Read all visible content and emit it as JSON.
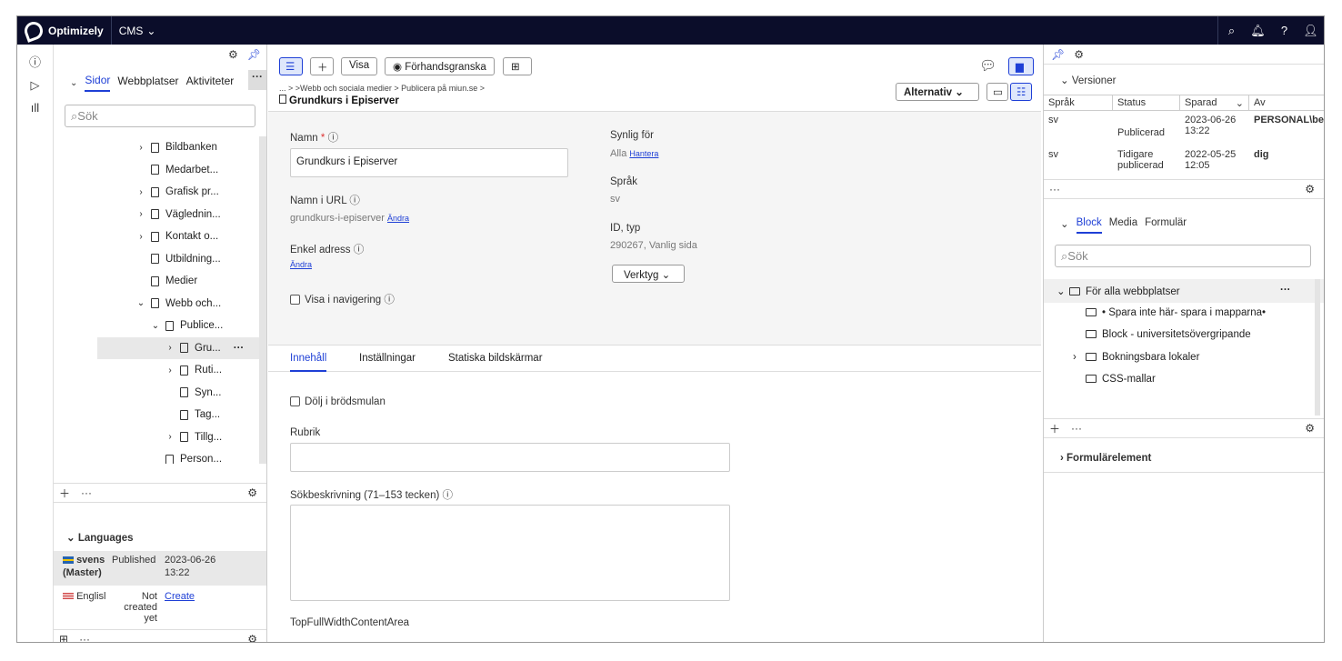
{
  "topbar": {
    "brand": "Optimizely",
    "product": "CMS"
  },
  "left": {
    "tabs": [
      "Sidor",
      "Webbplatser",
      "Aktiviteter"
    ],
    "search_placeholder": "Sök",
    "tree": [
      {
        "label": "Bildbanken",
        "indent": 0,
        "expand": true
      },
      {
        "label": "Medarbet...",
        "indent": 0,
        "expand": false
      },
      {
        "label": "Grafisk pr...",
        "indent": 0,
        "expand": true
      },
      {
        "label": "Vägledni­n...",
        "indent": 0,
        "expand": true
      },
      {
        "label": "Kontakt o...",
        "indent": 0,
        "expand": true
      },
      {
        "label": "Utbildning...",
        "indent": 0,
        "expand": false
      },
      {
        "label": "Medier",
        "indent": 0,
        "expand": false
      },
      {
        "label": "Webb och...",
        "indent": 0,
        "expand": "open"
      },
      {
        "label": "Publice...",
        "indent": 1,
        "expand": "open"
      },
      {
        "label": "Gru...",
        "indent": 2,
        "expand": true,
        "selected": true
      },
      {
        "label": "Ruti...",
        "indent": 2,
        "expand": true
      },
      {
        "label": "Syn...",
        "indent": 2,
        "expand": false
      },
      {
        "label": "Tag...",
        "indent": 2,
        "expand": false
      },
      {
        "label": "Tillg...",
        "indent": 2,
        "expand": true
      },
      {
        "label": "Person...",
        "indent": 1,
        "expand": false
      }
    ],
    "languages": {
      "heading": "Languages",
      "master": {
        "name": "svens",
        "suffix": "(Master)",
        "status": "Published",
        "date": "2023-06-26",
        "time": "13:22"
      },
      "english": {
        "name": "Englisl",
        "status": "Not created yet",
        "action": "Create"
      }
    }
  },
  "toolbar": {
    "visa": "Visa",
    "preview": "Förhandsgranska",
    "breadcrumb": "... > >Webb och sociala medier > Publicera på miun.se >",
    "title": "Grundkurs i Episerver",
    "alternativ": "Alternativ"
  },
  "form": {
    "namn_label": "Namn",
    "namn_value": "Grundkurs i Episerver",
    "url_label": "Namn i URL",
    "url_value": "grundkurs-i-episerver",
    "andra": "Ändra",
    "enkel_label": "Enkel adress",
    "visa_nav": "Visa i navigering",
    "synlig_label": "Synlig för",
    "synlig_value": "Alla",
    "hantera": "Hantera",
    "sprak_label": "Språk",
    "sprak_value": "sv",
    "id_label": "ID, typ",
    "id_value": "290267, Vanlig sida",
    "verktyg": "Verktyg"
  },
  "content_tabs": [
    "Innehåll",
    "Inställningar",
    "Statiska bildskärmar"
  ],
  "content": {
    "dolj": "Dölj i brödsmulan",
    "rubrik": "Rubrik",
    "sokbeskrivning": "Sökbeskrivning (71–153 tecken)",
    "top_area": "TopFullWidthContentArea"
  },
  "right": {
    "versions_title": "Versioner",
    "headers": [
      "Språk",
      "Status",
      "Sparad",
      "Av"
    ],
    "rows": [
      {
        "lang": "sv",
        "status": "Publicerad",
        "date": "2023-06-26",
        "time": "13:22",
        "by": "PERSONAL\\be"
      },
      {
        "lang": "sv",
        "status": "Tidigare publicerad",
        "date": "2022-05-25",
        "time": "12:05",
        "by": "dig"
      }
    ],
    "block_tabs": [
      "Block",
      "Media",
      "Formulär"
    ],
    "search_placeholder": "Sök",
    "block_tree": [
      {
        "label": "För alla webbplatser",
        "level": 0
      },
      {
        "label": "• Spara inte här- spara i mapparna•",
        "level": 1
      },
      {
        "label": "Block - universitetsövergripande",
        "level": 1
      },
      {
        "label": "Bokningsbara lokaler",
        "level": 1,
        "expand": true
      },
      {
        "label": "CSS-mallar",
        "level": 1
      }
    ],
    "form_elements": "Formulärelement"
  }
}
